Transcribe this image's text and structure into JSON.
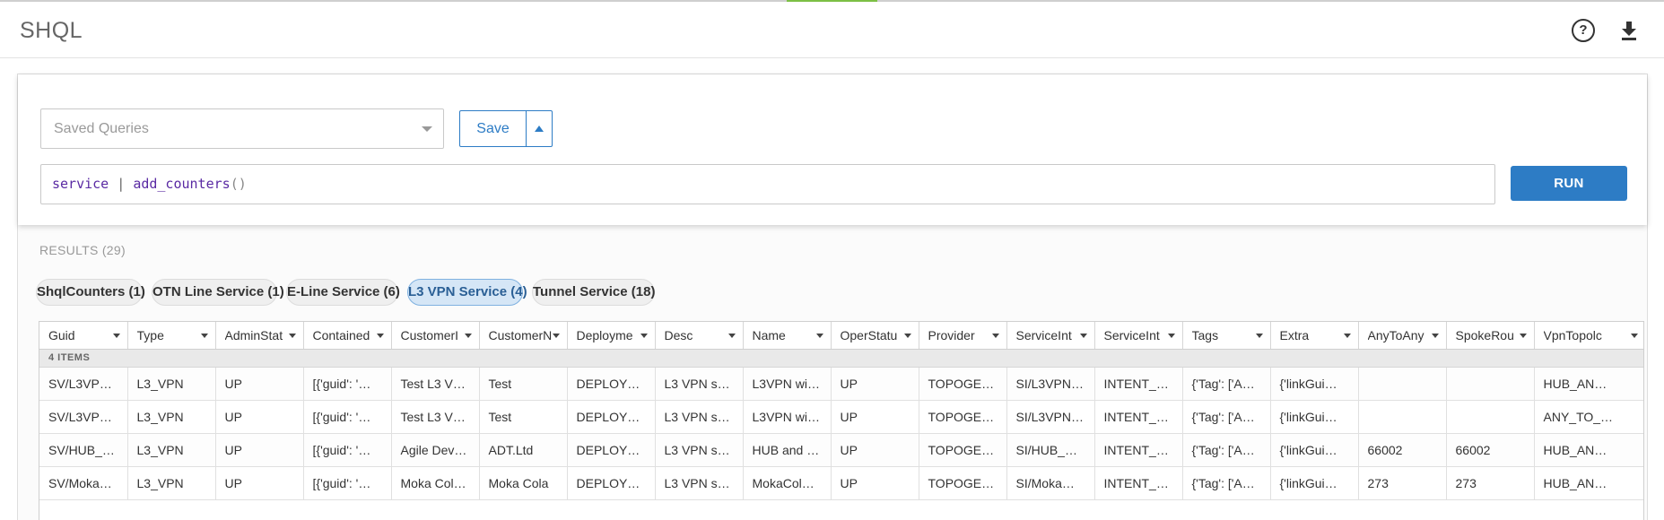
{
  "header": {
    "title": "SHQL",
    "help_icon": "help-circle-icon",
    "download_icon": "download-icon"
  },
  "colors": {
    "accent": "#2d7cc5",
    "top_tab": "#7cbf44",
    "active_tab_bg": "#d5e6f6"
  },
  "query": {
    "saved_placeholder": "Saved Queries",
    "save_label": "Save",
    "text_parts": {
      "kw": "service",
      "op": " | ",
      "fn": "add_counters",
      "paren": "()"
    },
    "run_label": "RUN"
  },
  "results": {
    "label": "RESULTS (29)",
    "tabs": [
      {
        "label": "ShqlCounters (1)",
        "active": false
      },
      {
        "label": "OTN Line Service (1)",
        "active": false
      },
      {
        "label": "E-Line Service (6)",
        "active": false
      },
      {
        "label": "L3 VPN Service (4)",
        "active": true
      },
      {
        "label": "Tunnel Service (18)",
        "active": false
      }
    ],
    "columns": [
      "Guid",
      "Type",
      "AdminStat",
      "Contained",
      "CustomerI",
      "CustomerN",
      "Deployme",
      "Desc",
      "Name",
      "OperStatu",
      "Provider",
      "ServiceInt",
      "ServiceInt",
      "Tags",
      "Extra",
      "AnyToAny",
      "SpokeRou",
      "VpnTopolc"
    ],
    "group_label": "4 ITEMS",
    "rows": [
      [
        "SV/L3VP…",
        "L3_VPN",
        "UP",
        "[{'guid': '…",
        "Test L3 V…",
        "Test",
        "DEPLOY…",
        "L3 VPN s…",
        "L3VPN wi…",
        "UP",
        "TOPOGE…",
        "SI/L3VPN…",
        "INTENT_…",
        "{'Tag': ['A…",
        "{'linkGui…",
        "",
        "",
        "HUB_AN…"
      ],
      [
        "SV/L3VP…",
        "L3_VPN",
        "UP",
        "[{'guid': '…",
        "Test L3 V…",
        "Test",
        "DEPLOY…",
        "L3 VPN s…",
        "L3VPN wi…",
        "UP",
        "TOPOGE…",
        "SI/L3VPN…",
        "INTENT_…",
        "{'Tag': ['A…",
        "{'linkGui…",
        "",
        "",
        "ANY_TO_…"
      ],
      [
        "SV/HUB_…",
        "L3_VPN",
        "UP",
        "[{'guid': '…",
        "Agile Dev…",
        "ADT.Ltd",
        "DEPLOY…",
        "L3 VPN s…",
        "HUB and …",
        "UP",
        "TOPOGE…",
        "SI/HUB_…",
        "INTENT_…",
        "{'Tag': ['A…",
        "{'linkGui…",
        "66002",
        "66002",
        "HUB_AN…"
      ],
      [
        "SV/Moka…",
        "L3_VPN",
        "UP",
        "[{'guid': '…",
        "Moka Col…",
        "Moka Cola",
        "DEPLOY…",
        "L3 VPN s…",
        "MokaCol…",
        "UP",
        "TOPOGE…",
        "SI/Moka…",
        "INTENT_…",
        "{'Tag': ['A…",
        "{'linkGui…",
        "273",
        "273",
        "HUB_AN…"
      ]
    ]
  }
}
